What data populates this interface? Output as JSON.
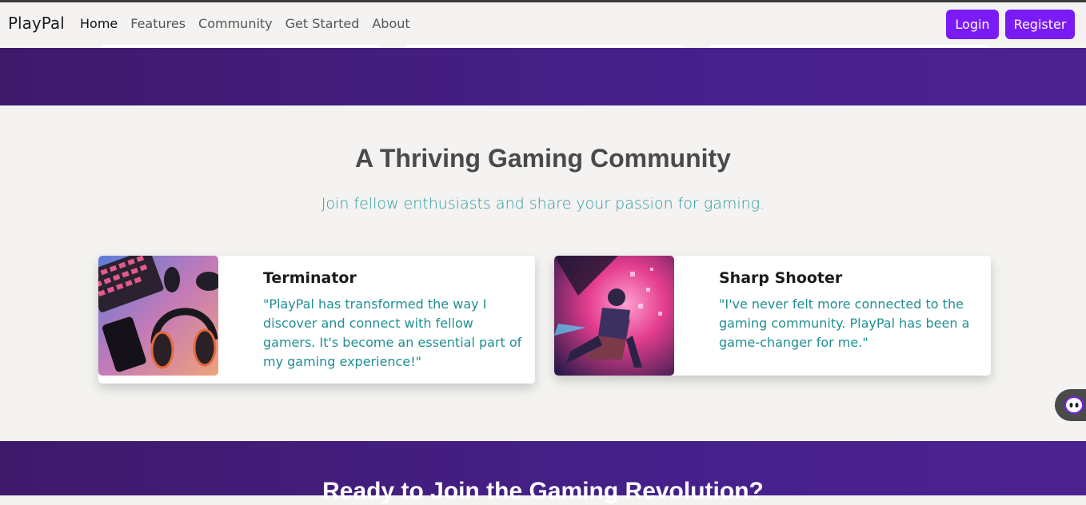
{
  "nav": {
    "brand": "PlayPal",
    "links": [
      "Home",
      "Features",
      "Community",
      "Get Started",
      "About"
    ],
    "login_label": "Login",
    "register_label": "Register"
  },
  "community": {
    "title": "A Thriving Gaming Community",
    "subtitle": "Join fellow enthusiasts and share your passion for gaming.",
    "testimonials": [
      {
        "name": "Terminator",
        "quote": "\"PlayPal has transformed the way I discover and connect with fellow gamers. It's become an essential part of my gaming experience!\""
      },
      {
        "name": "Sharp Shooter",
        "quote": "\"I've never felt more connected to the gaming community. PlayPal has been a game-changer for me.\""
      }
    ]
  },
  "cta": {
    "title": "Ready to Join the Gaming Revolution?"
  },
  "colors": {
    "accent": "#7a1bf5",
    "hero_purple": "#45208a",
    "teal_text": "#2a9aa0"
  }
}
